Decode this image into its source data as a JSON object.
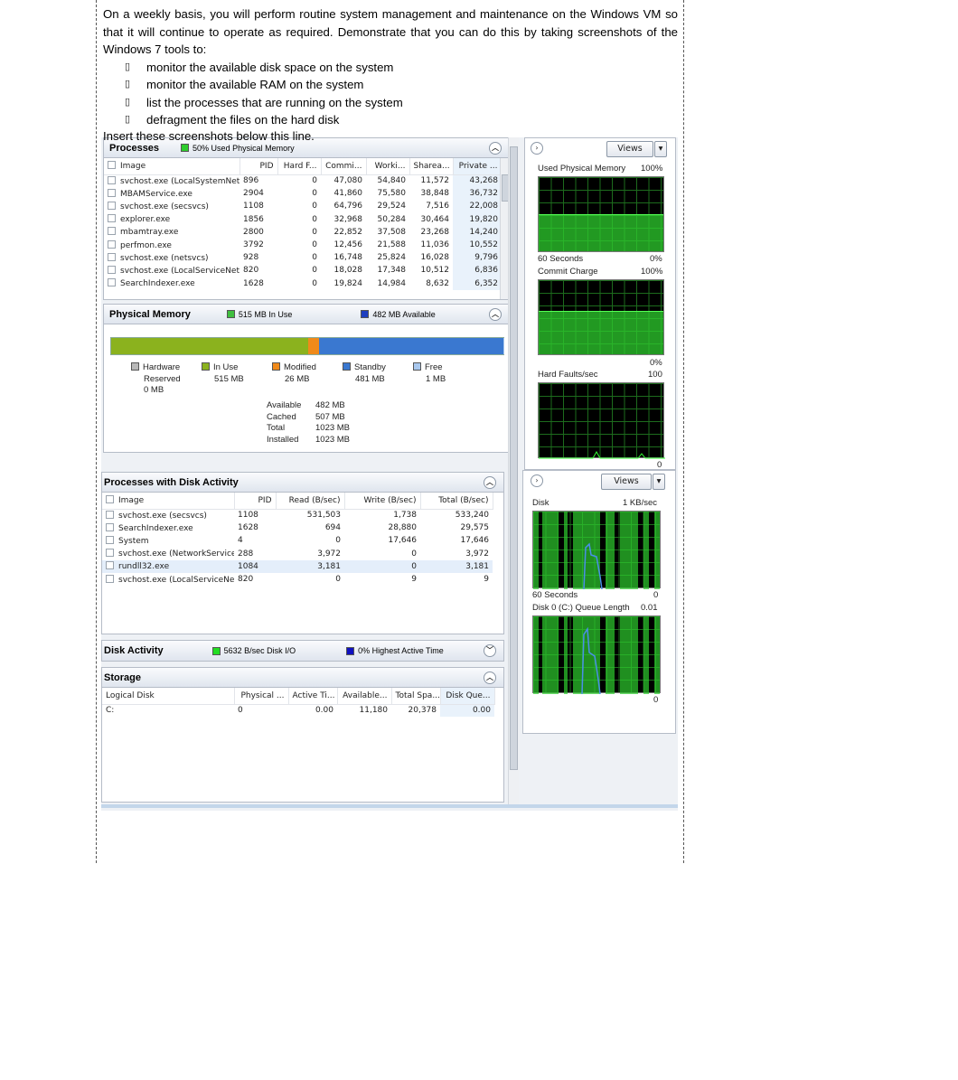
{
  "doc": {
    "intro": "On a weekly basis, you will perform routine system management and maintenance on the Windows VM so that it will continue to operate as required. Demonstrate that you can do this by taking screenshots of the Windows 7 tools to:",
    "bullet_mark": "▯",
    "bullets": [
      "monitor the available disk space on the system",
      "monitor the available RAM on the system",
      "list the processes that are running on the system",
      "defragment the files on the hard disk"
    ],
    "instruction": "Insert these screenshots below this line."
  },
  "resmon": {
    "processes": {
      "title": "Processes",
      "badge": "50% Used Physical Memory",
      "badge_color": "#2ecc2e",
      "columns": [
        "Image",
        "PID",
        "Hard F...",
        "Commi...",
        "Worki...",
        "Sharea...",
        "Private ..."
      ],
      "rows": [
        [
          "svchost.exe (LocalSystemNet...",
          "896",
          "0",
          "47,080",
          "54,840",
          "11,572",
          "43,268"
        ],
        [
          "MBAMService.exe",
          "2904",
          "0",
          "41,860",
          "75,580",
          "38,848",
          "36,732"
        ],
        [
          "svchost.exe (secsvcs)",
          "1108",
          "0",
          "64,796",
          "29,524",
          "7,516",
          "22,008"
        ],
        [
          "explorer.exe",
          "1856",
          "0",
          "32,968",
          "50,284",
          "30,464",
          "19,820"
        ],
        [
          "mbamtray.exe",
          "2800",
          "0",
          "22,852",
          "37,508",
          "23,268",
          "14,240"
        ],
        [
          "perfmon.exe",
          "3792",
          "0",
          "12,456",
          "21,588",
          "11,036",
          "10,552"
        ],
        [
          "svchost.exe (netsvcs)",
          "928",
          "0",
          "16,748",
          "25,824",
          "16,028",
          "9,796"
        ],
        [
          "svchost.exe (LocalServiceNet...",
          "820",
          "0",
          "18,028",
          "17,348",
          "10,512",
          "6,836"
        ],
        [
          "SearchIndexer.exe",
          "1628",
          "0",
          "19,824",
          "14,984",
          "8,632",
          "6,352"
        ]
      ]
    },
    "physical_memory": {
      "title": "Physical Memory",
      "in_use_badge": "515 MB In Use",
      "in_use_color": "#3fbf3f",
      "available_badge": "482 MB Available",
      "available_color": "#1f3fbf",
      "bar": {
        "hardware_mb": 0,
        "in_use_mb": 515,
        "modified_mb": 26,
        "standby_mb": 481,
        "free_mb": 1
      },
      "legend": [
        {
          "name": "Hardware",
          "sub": "Reserved",
          "value": "0 MB",
          "color": "#b8b8b8"
        },
        {
          "name": "In Use",
          "value": "515 MB",
          "color": "#8bb21e"
        },
        {
          "name": "Modified",
          "value": "26 MB",
          "color": "#f08a1a"
        },
        {
          "name": "Standby",
          "value": "481 MB",
          "color": "#3a78d0"
        },
        {
          "name": "Free",
          "value": "1 MB",
          "color": "#a9c8ee"
        }
      ],
      "stats": [
        [
          "Available",
          "482 MB"
        ],
        [
          "Cached",
          "507 MB"
        ],
        [
          "Total",
          "1023 MB"
        ],
        [
          "Installed",
          "1023 MB"
        ]
      ]
    },
    "mem_graphs": {
      "views_label": "Views",
      "used_title": "Used Physical Memory",
      "used_max": "100%",
      "used_min": "0%",
      "seconds": "60 Seconds",
      "used_percent": 50,
      "commit_title": "Commit Charge",
      "commit_max": "100%",
      "commit_min": "0%",
      "commit_percent": 58,
      "faults_title": "Hard Faults/sec",
      "faults_max": "100",
      "faults_min": "0"
    },
    "disk_processes": {
      "title": "Processes with Disk Activity",
      "columns": [
        "Image",
        "PID",
        "Read (B/sec)",
        "Write (B/sec)",
        "Total (B/sec)"
      ],
      "rows": [
        [
          "svchost.exe (secsvcs)",
          "1108",
          "531,503",
          "1,738",
          "533,240"
        ],
        [
          "SearchIndexer.exe",
          "1628",
          "694",
          "28,880",
          "29,575"
        ],
        [
          "System",
          "4",
          "0",
          "17,646",
          "17,646"
        ],
        [
          "svchost.exe (NetworkService)",
          "288",
          "3,972",
          "0",
          "3,972"
        ],
        [
          "rundll32.exe",
          "1084",
          "3,181",
          "0",
          "3,181"
        ],
        [
          "svchost.exe (LocalServiceNet...",
          "820",
          "0",
          "9",
          "9"
        ]
      ]
    },
    "disk_activity": {
      "title": "Disk Activity",
      "io_badge": "5632 B/sec Disk I/O",
      "io_color": "#22dd22",
      "active_badge": "0% Highest Active Time",
      "active_color": "#1010c0"
    },
    "storage": {
      "title": "Storage",
      "columns": [
        "Logical Disk",
        "Physical ...",
        "Active Ti...",
        "Available...",
        "Total Spa...",
        "Disk Que..."
      ],
      "rows": [
        [
          "C:",
          "0",
          "0.00",
          "11,180",
          "20,378",
          "0.00"
        ]
      ]
    },
    "disk_graphs": {
      "views_label": "Views",
      "disk_title": "Disk",
      "disk_max": "1 KB/sec",
      "disk_min": "0",
      "seconds": "60 Seconds",
      "queue_title": "Disk 0 (C:) Queue Length",
      "queue_max": "0.01",
      "queue_min": "0"
    }
  }
}
